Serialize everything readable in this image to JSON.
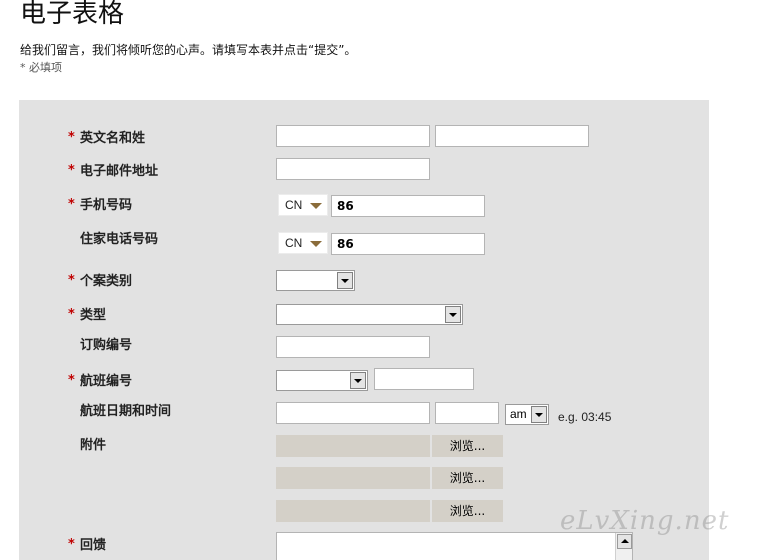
{
  "header": {
    "title": "电子表格",
    "intro": "给我们留言，我们将倾听您的心声。请填写本表并点击“提交”。",
    "required_note": "* 必填项"
  },
  "form": {
    "required_marker": "*",
    "name": {
      "label": "英文名和姓",
      "required": true,
      "first_value": "",
      "last_value": ""
    },
    "email": {
      "label": "电子邮件地址",
      "required": true,
      "value": ""
    },
    "mobile": {
      "label": "手机号码",
      "required": true,
      "country": "CN",
      "value": "86"
    },
    "home_phone": {
      "label": "住家电话号码",
      "required": false,
      "country": "CN",
      "value": "86"
    },
    "case_category": {
      "label": "个案类别",
      "required": true,
      "selected": ""
    },
    "type": {
      "label": "类型",
      "required": true,
      "selected": ""
    },
    "order_number": {
      "label": "订购编号",
      "required": false,
      "value": ""
    },
    "flight_number": {
      "label": "航班编号",
      "required": true,
      "selected": "",
      "value": ""
    },
    "flight_datetime": {
      "label": "航班日期和时间",
      "required": false,
      "date": "",
      "time": "",
      "ampm": "am",
      "hint": "e.g. 03:45"
    },
    "attachment": {
      "label": "附件",
      "browse_label": "浏览..."
    },
    "feedback": {
      "label": "回馈",
      "required": true,
      "value": ""
    }
  },
  "watermark": "eLvXing.net"
}
